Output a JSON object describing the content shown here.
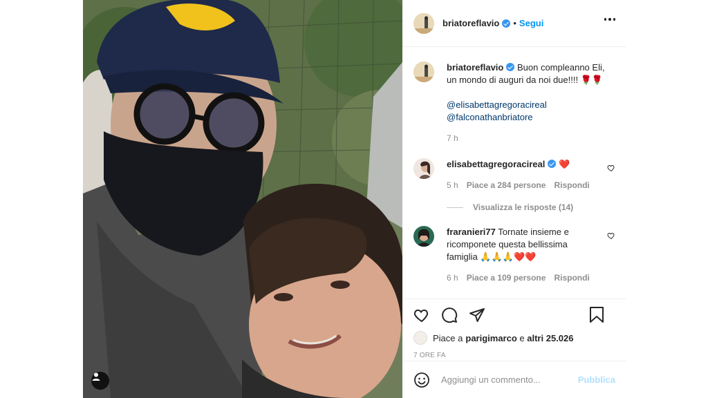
{
  "post": {
    "author": "briatoreflavio",
    "follow_label": "Segui",
    "separator": "•",
    "caption_line1": "Buon compleanno Eli,",
    "caption_line2": "un mondo di auguri da noi due!!!! 🌹🌹",
    "mentions": [
      "@elisabettagregoracireal",
      "@falconathanbriatore"
    ],
    "caption_time": "7 h"
  },
  "comments": [
    {
      "user": "elisabettagregoracireal",
      "text": "❤️",
      "time": "5 h",
      "likes": "Piace a 284 persone",
      "reply": "Rispondi",
      "view_replies": "Visualizza le risposte (14)"
    },
    {
      "user": "fraranieri77",
      "text_line1": "Tornate insieme e",
      "text_line2": "ricomponete questa bellissima",
      "text_line3": "famiglia 🙏🙏🙏❤️❤️",
      "time": "6 h",
      "likes": "Piace a 109 persone",
      "reply": "Rispondi"
    }
  ],
  "likes_summary": {
    "prefix": "Piace a ",
    "user": "parigimarco",
    "middle": " e ",
    "rest": "altri 25.026"
  },
  "post_time": "7 ORE FA",
  "add_comment": {
    "placeholder": "Aggiungi un commento...",
    "publish": "Pubblica"
  },
  "icons": {
    "like": "heart-icon",
    "comment": "comment-icon",
    "share": "paper-plane-icon",
    "save": "bookmark-icon",
    "more": "more-options-icon",
    "emoji": "emoji-icon",
    "tag": "user-tag-icon"
  },
  "colors": {
    "follow": "#0095f6",
    "verified": "#3897f0",
    "mention": "#00376b",
    "secondary_text": "#8e8e8e",
    "publish_disabled": "#b2dffc"
  }
}
